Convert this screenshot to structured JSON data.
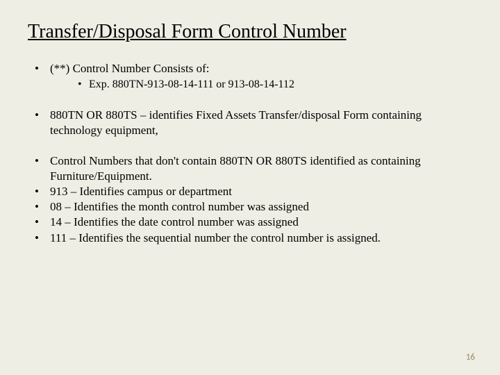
{
  "slide": {
    "title": "Transfer/Disposal Form Control Number",
    "bullets": {
      "b0": "(**) Control Number Consists of:",
      "b0_sub": "Exp. 880TN-913-08-14-111 or 913-08-14-112",
      "b1": "880TN OR 880TS – identifies Fixed Assets Transfer/disposal Form containing technology equipment,",
      "b2": "Control Numbers that don't contain 880TN OR 880TS identified as containing Furniture/Equipment.",
      "b3": "913 – Identifies campus or department",
      "b4": "08   – Identifies the month control number was assigned",
      "b5": "14   – Identifies the date control number was assigned",
      "b6": "111 – Identifies the sequential number the control number is assigned."
    },
    "page_number": "16"
  }
}
